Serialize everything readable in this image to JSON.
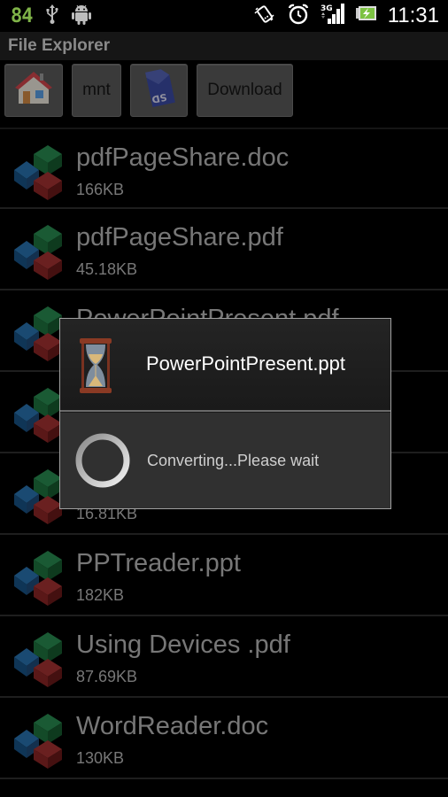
{
  "status_bar": {
    "battery_level": "84",
    "time": "11:31",
    "network_type": "3G",
    "left_icons": [
      "usb-icon",
      "android-icon"
    ],
    "right_icons": [
      "screen-rotate-icon",
      "alarm-icon",
      "signal-3g-icon",
      "battery-charging-icon"
    ]
  },
  "app": {
    "title": "File Explorer"
  },
  "path_bar": {
    "items": [
      {
        "label": "",
        "icon": "home-icon"
      },
      {
        "label": "mnt",
        "icon": ""
      },
      {
        "label": "",
        "icon": "sd-card-icon"
      },
      {
        "label": "Download",
        "icon": ""
      }
    ]
  },
  "files": [
    {
      "name": "pdfPageShare.doc",
      "size": "166KB"
    },
    {
      "name": "pdfPageShare.pdf",
      "size": "45.18KB"
    },
    {
      "name": "PowerPointPresent.pdf",
      "size": ""
    },
    {
      "name": "",
      "size": ""
    },
    {
      "name": "",
      "size": "16.81KB"
    },
    {
      "name": "PPTreader.ppt",
      "size": "182KB"
    },
    {
      "name": "Using Devices .pdf",
      "size": "87.69KB"
    },
    {
      "name": "WordReader.doc",
      "size": "130KB"
    }
  ],
  "dialog": {
    "title": "PowerPointPresent.ppt",
    "message": "Converting...Please wait",
    "icon": "hourglass-icon"
  },
  "colors": {
    "battery_text": "#7fb348",
    "cube_blue": "#163a5a",
    "cube_green": "#13472a",
    "cube_red": "#4f1616"
  }
}
